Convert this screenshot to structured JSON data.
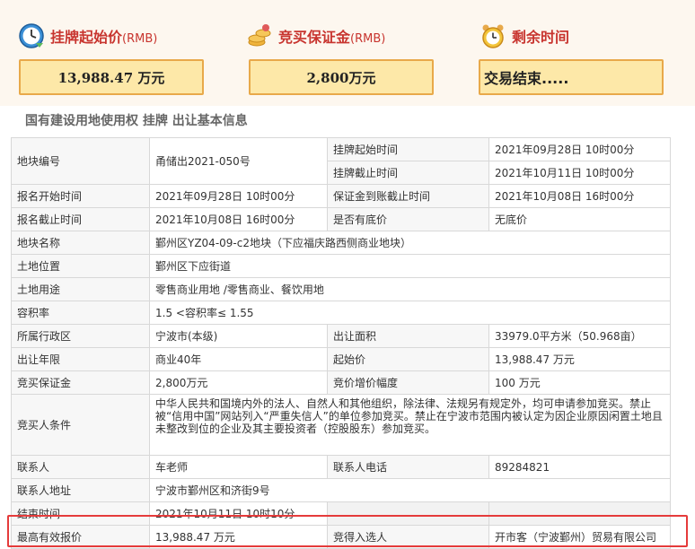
{
  "header": {
    "start_price": {
      "label": "挂牌起始价",
      "unit": "(RMB)",
      "value": "13,988.47 万元",
      "icon": "clock-icon"
    },
    "deposit": {
      "label": "竞买保证金",
      "unit": "(RMB)",
      "value": "2,800万元",
      "icon": "coins-icon"
    },
    "remaining": {
      "label": "剩余时间",
      "value": "交易结束.....",
      "icon": "alarm-clock-icon"
    }
  },
  "section_title": "国有建设用地使用权 挂牌 出让基本信息",
  "rows": {
    "parcel_no": {
      "label": "地块编号",
      "value": "甬储出2021-050号"
    },
    "listing_start": {
      "label": "挂牌起始时间",
      "value": "2021年09月28日 10时00分"
    },
    "listing_end": {
      "label": "挂牌截止时间",
      "value": "2021年10月11日 10时00分"
    },
    "reg_start": {
      "label": "报名开始时间",
      "value": "2021年09月28日 10时00分"
    },
    "deposit_deadline": {
      "label": "保证金到账截止时间",
      "value": "2021年10月08日 16时00分"
    },
    "reg_end": {
      "label": "报名截止时间",
      "value": "2021年10月08日 16时00分"
    },
    "reserve_price": {
      "label": "是否有底价",
      "value": "无底价"
    },
    "parcel_name": {
      "label": "地块名称",
      "value": "鄞州区YZ04-09-c2地块（下应福庆路西侧商业地块）"
    },
    "location": {
      "label": "土地位置",
      "value": "鄞州区下应街道"
    },
    "usage": {
      "label": "土地用途",
      "value": "零售商业用地 /零售商业、餐饮用地"
    },
    "far": {
      "label": "容积率",
      "value": "1.5 <容积率≤ 1.55"
    },
    "district": {
      "label": "所属行政区",
      "value": "宁波市(本级)"
    },
    "area": {
      "label": "出让面积",
      "value": "33979.0平方米（50.968亩）"
    },
    "term": {
      "label": "出让年限",
      "value": "商业40年"
    },
    "start_price": {
      "label": "起始价",
      "value": "13,988.47 万元"
    },
    "deposit": {
      "label": "竞买保证金",
      "value": "2,800万元"
    },
    "increment": {
      "label": "竞价增价幅度",
      "value": "100 万元"
    },
    "conditions": {
      "label": "竞买人条件",
      "value": "中华人民共和国境内外的法人、自然人和其他组织，除法律、法规另有规定外，均可申请参加竞买。禁止被“信用中国”网站列入“严重失信人”的单位参加竞买。禁止在宁波市范围内被认定为因企业原因闲置土地且未整改到位的企业及其主要投资者（控股股东）参加竞买。"
    },
    "contact": {
      "label": "联系人",
      "value": "车老师"
    },
    "phone": {
      "label": "联系人电话",
      "value": "89284821"
    },
    "address": {
      "label": "联系人地址",
      "value": "宁波市鄞州区和济街9号"
    },
    "end_time": {
      "label": "结束时间",
      "value": "2021年10月11日 10时10分"
    },
    "top_bid": {
      "label": "最高有效报价",
      "value": "13,988.47 万元"
    },
    "winner": {
      "label": "竞得入选人",
      "value": "开市客（宁波鄞州）贸易有限公司"
    }
  }
}
